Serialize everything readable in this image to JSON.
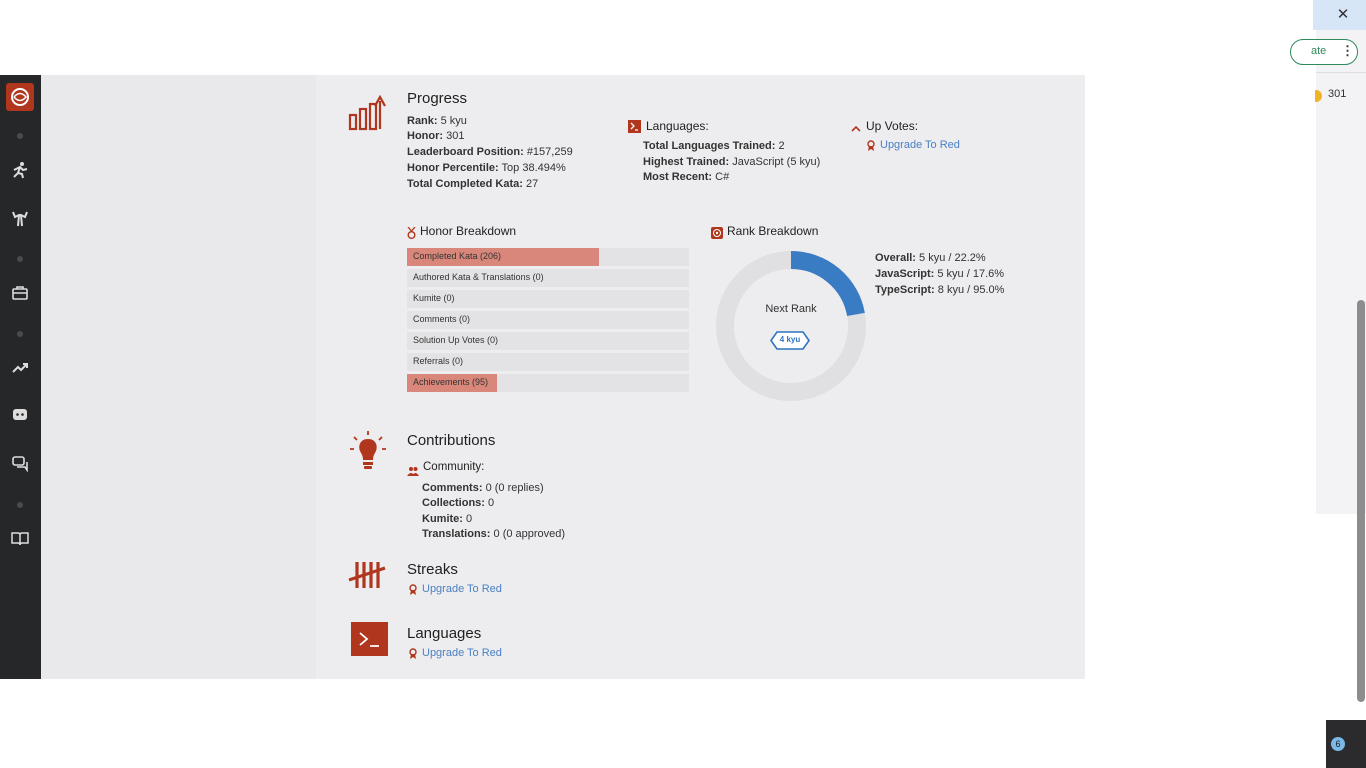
{
  "browser": {
    "close_glyph": "✕",
    "update_chip_label": "ate",
    "menu_glyph": "⋮",
    "honor_value": "301",
    "tray_badge": "6"
  },
  "progress": {
    "title": "Progress",
    "items": [
      {
        "key": "Rank:",
        "value": "5 kyu"
      },
      {
        "key": "Honor:",
        "value": "301"
      },
      {
        "key": "Leaderboard Position:",
        "value": "#157,259"
      },
      {
        "key": "Honor Percentile:",
        "value": "Top 38.494%"
      },
      {
        "key": "Total Completed Kata:",
        "value": "27"
      }
    ]
  },
  "languages_summary": {
    "title": "Languages:",
    "items": [
      {
        "key": "Total Languages Trained:",
        "value": "2"
      },
      {
        "key": "Highest Trained:",
        "value": "JavaScript (5 kyu)"
      },
      {
        "key": "Most Recent:",
        "value": "C#"
      }
    ]
  },
  "up_votes": {
    "title": "Up Votes:",
    "link": "Upgrade To Red"
  },
  "honor_breakdown": {
    "title": "Honor Breakdown",
    "bars": [
      {
        "label": "Completed Kata (206)",
        "fill": 0.68
      },
      {
        "label": "Authored Kata & Translations (0)",
        "fill": 0
      },
      {
        "label": "Kumite (0)",
        "fill": 0
      },
      {
        "label": "Comments (0)",
        "fill": 0
      },
      {
        "label": "Solution Up Votes (0)",
        "fill": 0
      },
      {
        "label": "Referrals (0)",
        "fill": 0
      },
      {
        "label": "Achievements (95)",
        "fill": 0.32
      }
    ]
  },
  "rank_breakdown": {
    "title": "Rank Breakdown",
    "next_rank_label": "Next Rank",
    "next_rank_badge": "4 kyu",
    "progress_fraction": 0.222,
    "items": [
      {
        "key": "Overall:",
        "value": "5 kyu / 22.2%"
      },
      {
        "key": "JavaScript:",
        "value": "5 kyu / 17.6%"
      },
      {
        "key": "TypeScript:",
        "value": "8 kyu / 95.0%"
      }
    ]
  },
  "contributions": {
    "title": "Contributions",
    "community_label": "Community:",
    "items": [
      {
        "key": "Comments:",
        "value": "0 (0 replies)"
      },
      {
        "key": "Collections:",
        "value": "0"
      },
      {
        "key": "Kumite:",
        "value": "0"
      },
      {
        "key": "Translations:",
        "value": "0 (0 approved)"
      }
    ]
  },
  "streaks": {
    "title": "Streaks",
    "link": "Upgrade To Red"
  },
  "languages_section": {
    "title": "Languages",
    "link": "Upgrade To Red"
  },
  "colors": {
    "accent": "#b1361e",
    "link": "#4a80c4",
    "donut_fill": "#3a7cc4",
    "donut_track": "#e0e0e2"
  }
}
